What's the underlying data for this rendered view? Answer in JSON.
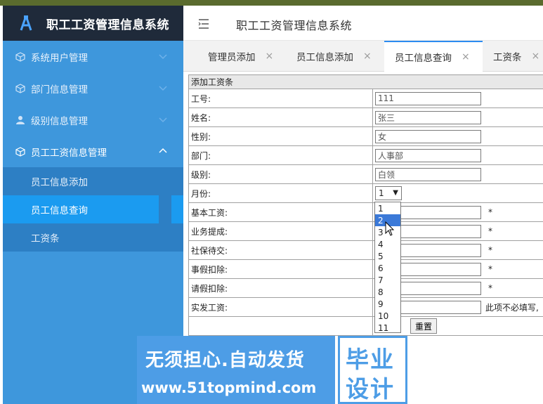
{
  "app": {
    "title": "职工工资管理信息系统",
    "header_title": "职工工资管理信息系统"
  },
  "sidebar": {
    "items": [
      {
        "label": "系统用户管理",
        "icon": "cube-icon"
      },
      {
        "label": "部门信息管理",
        "icon": "cube-icon"
      },
      {
        "label": "级别信息管理",
        "icon": "user-icon"
      },
      {
        "label": "员工工资信息管理",
        "icon": "cube-icon",
        "expanded": true
      }
    ],
    "submenu": [
      {
        "label": "员工信息添加"
      },
      {
        "label": "员工信息查询",
        "current": true
      },
      {
        "label": "工资条"
      }
    ]
  },
  "tabs": [
    {
      "label": "管理员添加",
      "close": "×"
    },
    {
      "label": "员工信息添加",
      "close": "×"
    },
    {
      "label": "员工信息查询",
      "close": "×",
      "selected": true
    },
    {
      "label": "工资条",
      "close": "×"
    }
  ],
  "form": {
    "heading": "添加工资条",
    "rows": {
      "gonghao": {
        "label": "工号:",
        "value": "111"
      },
      "name": {
        "label": "姓名:",
        "value": "张三"
      },
      "gender": {
        "label": "性别:",
        "value": "女"
      },
      "dept": {
        "label": "部门:",
        "value": "人事部"
      },
      "level": {
        "label": "级别:",
        "value": "白领"
      },
      "month": {
        "label": "月份:",
        "value": "1"
      },
      "base": {
        "label": "基本工资:",
        "value": "",
        "required": "*"
      },
      "commission": {
        "label": "业务提成:",
        "value": "",
        "required": "*"
      },
      "social": {
        "label": "社保待交:",
        "value": "",
        "required": "*"
      },
      "leave_deduct": {
        "label": "事假扣除:",
        "value": "",
        "required": "*"
      },
      "sick_deduct": {
        "label": "请假扣除:",
        "value": "",
        "required": "*"
      },
      "actual": {
        "label": "实发工资:",
        "value": "",
        "note": "此项不必填写,"
      }
    },
    "buttons": {
      "reset": "重置"
    }
  },
  "month_dropdown": {
    "options": [
      "1",
      "2",
      "3",
      "4",
      "5",
      "6",
      "7",
      "8",
      "9",
      "10",
      "11"
    ],
    "highlighted": "2"
  },
  "watermark": {
    "line1": "无须担心.自动发货",
    "line2": "www.51topmind.com",
    "right1": "毕业",
    "right2": "设计"
  },
  "colors": {
    "sidebar": "#3e97dc",
    "brand_bg": "#1f2a3a",
    "submenu_bg": "#2d7fc4",
    "current_item": "#1b9bf0",
    "tab_accent": "#2d8cf0",
    "dropdown_highlight": "#3b79d8",
    "watermark": "#4d9de6"
  }
}
